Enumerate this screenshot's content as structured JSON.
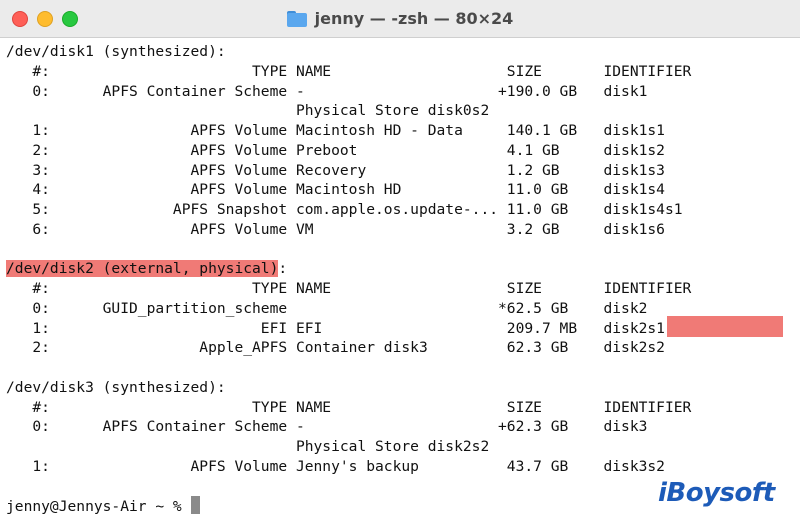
{
  "window": {
    "title": "jenny — -zsh — 80×24"
  },
  "terminal": {
    "lines": [
      "/dev/disk1 (synthesized):",
      "   #:                       TYPE NAME                    SIZE       IDENTIFIER",
      "   0:      APFS Container Scheme -                      +190.0 GB   disk1",
      "                                 Physical Store disk0s2",
      "   1:                APFS Volume Macintosh HD - Data     140.1 GB   disk1s1",
      "   2:                APFS Volume Preboot                 4.1 GB     disk1s2",
      "   3:                APFS Volume Recovery                1.2 GB     disk1s3",
      "   4:                APFS Volume Macintosh HD            11.0 GB    disk1s4",
      "   5:              APFS Snapshot com.apple.os.update-... 11.0 GB    disk1s4s1",
      "   6:                APFS Volume VM                      3.2 GB     disk1s6",
      "",
      "/dev/disk2 (external, physical)",
      "   #:                       TYPE NAME                    SIZE       IDENTIFIER",
      "   0:      GUID_partition_scheme                        *62.5 GB    disk2",
      "   1:                        EFI EFI                     209.7 MB   disk2s1",
      "   2:                 Apple_APFS Container disk3         62.3 GB    disk2s2",
      "",
      "/dev/disk3 (synthesized):",
      "   #:                       TYPE NAME                    SIZE       IDENTIFIER",
      "   0:      APFS Container Scheme -                      +62.3 GB    disk3",
      "                                 Physical Store disk2s2",
      "   1:                APFS Volume Jenny's backup          43.7 GB    disk3s2",
      "",
      "jenny@Jennys-Air ~ % "
    ],
    "disk2_header_suffix": ":"
  },
  "watermark": {
    "text": "iBoysoft"
  },
  "colors": {
    "highlight": "#f07a76",
    "titlebar": "#ebebeb"
  }
}
